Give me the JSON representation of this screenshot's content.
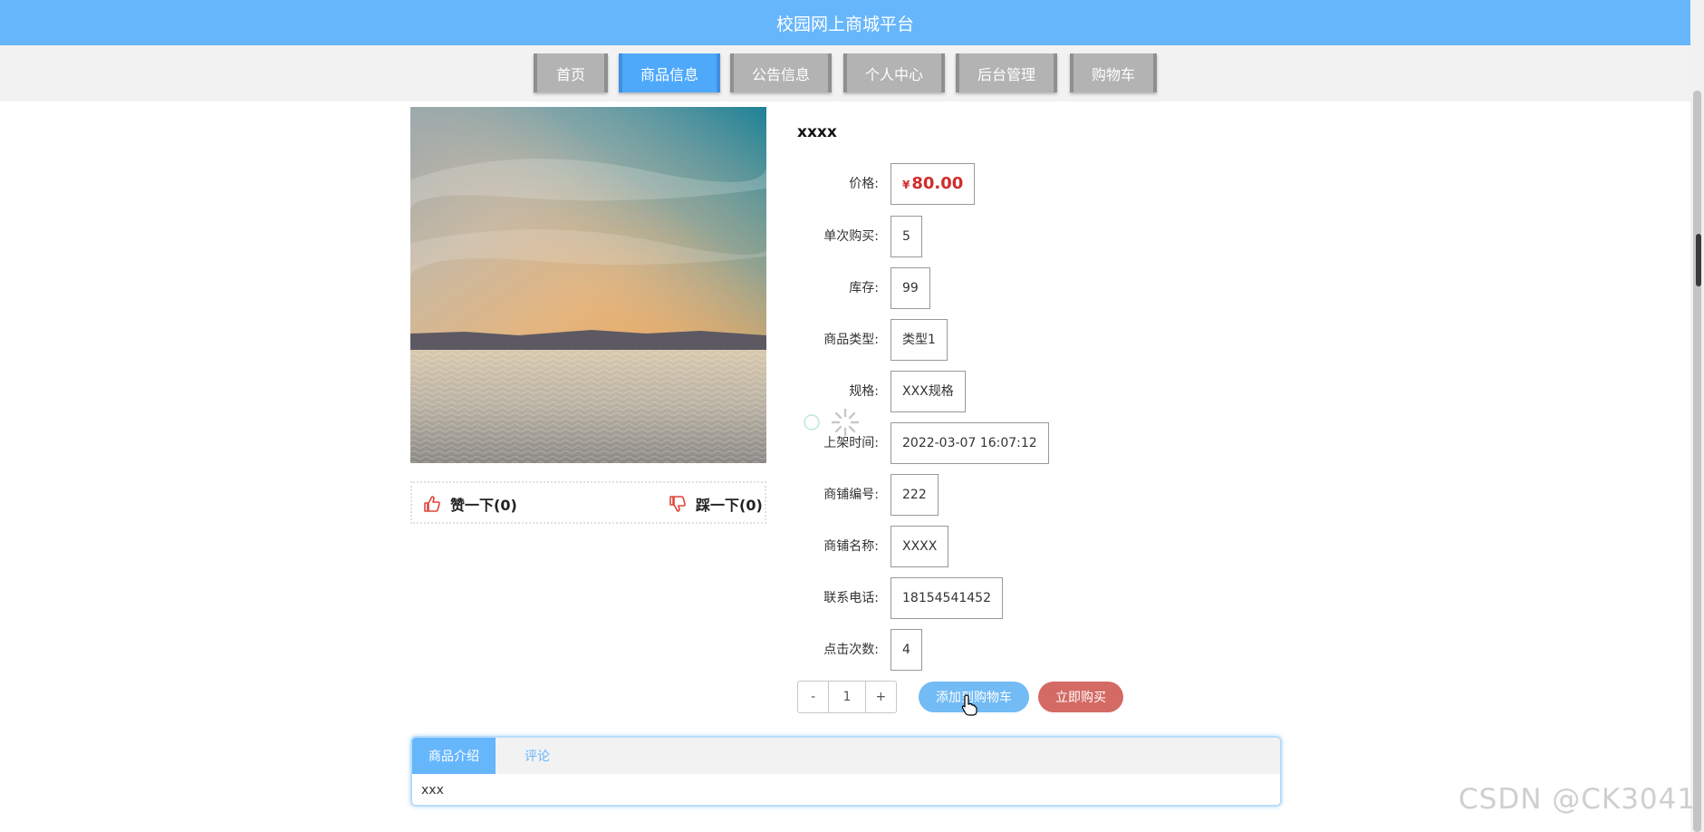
{
  "header": {
    "title": "校园网上商城平台"
  },
  "nav": [
    {
      "label": "首页",
      "active": false
    },
    {
      "label": "商品信息",
      "active": true
    },
    {
      "label": "公告信息",
      "active": false
    },
    {
      "label": "个人中心",
      "active": false
    },
    {
      "label": "后台管理",
      "active": false
    },
    {
      "label": "购物车",
      "active": false
    }
  ],
  "votes": {
    "like": "赞一下(0)",
    "dislike": "踩一下(0)"
  },
  "product": {
    "name": "xxxx",
    "currency": "¥",
    "price": "80.00",
    "fields": [
      {
        "label": "价格:",
        "value": ""
      },
      {
        "label": "单次购买:",
        "value": "5"
      },
      {
        "label": "库存:",
        "value": "99"
      },
      {
        "label": "商品类型:",
        "value": "类型1"
      },
      {
        "label": "规格:",
        "value": "XXX规格"
      },
      {
        "label": "上架时间:",
        "value": "2022-03-07 16:07:12"
      },
      {
        "label": "商铺编号:",
        "value": "222"
      },
      {
        "label": "商铺名称:",
        "value": "XXXX"
      },
      {
        "label": "联系电话:",
        "value": "18154541452"
      },
      {
        "label": "点击次数:",
        "value": "4"
      }
    ]
  },
  "quantity": {
    "minus": "-",
    "value": "1",
    "plus": "+"
  },
  "actions": {
    "add_to_cart": "添加到购物车",
    "buy_now": "立即购买"
  },
  "tabs": [
    {
      "label": "商品介绍"
    },
    {
      "label": "评论"
    }
  ],
  "tab_content": "xxx",
  "watermark": "CSDN @CK3041",
  "colors": {
    "header": "#66b6fc",
    "active_nav": "#4fa9fb",
    "price": "#d12b2b",
    "cart_button": "#72bbf5",
    "buy_button": "#d46a64"
  }
}
